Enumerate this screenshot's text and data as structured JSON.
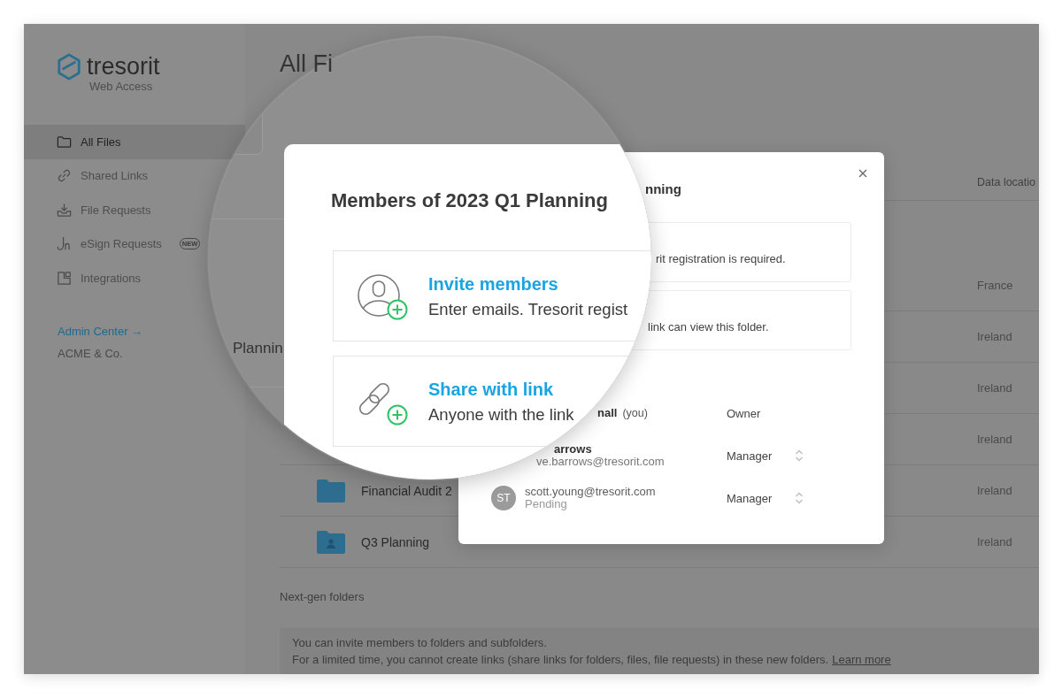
{
  "sidebar": {
    "logo": {
      "wordmark": "tresorit",
      "subtitle": "Web Access"
    },
    "items": [
      {
        "kind": "folder",
        "label": "All Files",
        "selected": true
      },
      {
        "kind": "link",
        "label": "Shared Links",
        "selected": false
      },
      {
        "kind": "inbox",
        "label": "File Requests",
        "selected": false
      },
      {
        "kind": "signature",
        "label": "eSign Requests",
        "selected": false,
        "badge": "NEW"
      },
      {
        "kind": "integrations",
        "label": "Integrations",
        "selected": false
      }
    ],
    "admin_link": "Admin Center →",
    "organization": "ACME & Co."
  },
  "main": {
    "title": "All Fi",
    "table": {
      "columns": [
        "Data locatio"
      ],
      "rows": [
        {
          "location": "France"
        },
        {
          "location": "Ireland"
        },
        {
          "location": "Ireland"
        },
        {
          "location": "Ireland"
        },
        {
          "name": "Financial Audit 2",
          "shared": false,
          "location": "Ireland"
        },
        {
          "name": "Q3 Planning",
          "shared": true,
          "location": "Ireland"
        }
      ]
    },
    "section": "Next-gen folders",
    "notice": {
      "lines": [
        "You can invite members to folders and subfolders.",
        "For a limited time, you cannot create links (share links for folders, files, file requests) in these new folders."
      ],
      "link": "Learn more"
    }
  },
  "modal": {
    "title": "nning",
    "options": [
      {
        "description": "rit registration is required."
      },
      {
        "description": "link can view this folder."
      }
    ],
    "members": [
      {
        "name": "nall",
        "note": "(you)",
        "role": "Owner",
        "changeable": false
      },
      {
        "name": "arrows",
        "email": "ve.barrows@tresorit.com",
        "role": "Manager",
        "changeable": true
      },
      {
        "initials": "ST",
        "email": "scott.young@tresorit.com",
        "status": "Pending",
        "role": "Manager",
        "changeable": true
      }
    ]
  },
  "magnifier": {
    "background_text": "Plannin",
    "dialog": {
      "title": "Members of 2023 Q1 Planning",
      "options": [
        {
          "kind": "invite",
          "title": "Invite members",
          "description": "Enter emails. Tresorit regist"
        },
        {
          "kind": "link",
          "title": "Share with link",
          "description": "Anyone with the link"
        }
      ]
    }
  }
}
